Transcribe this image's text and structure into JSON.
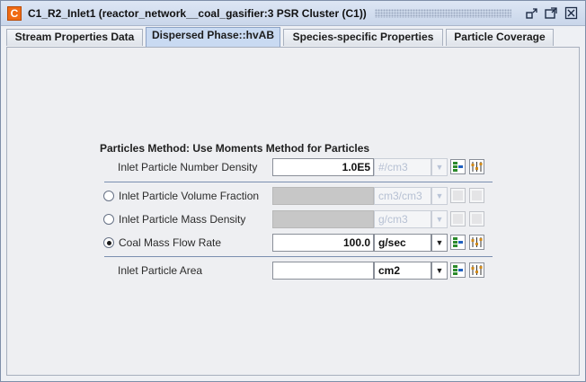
{
  "window": {
    "app_icon": "C",
    "title": "C1_R2_Inlet1  (reactor_network__coal_gasifier:3 PSR Cluster (C1))",
    "controls": {
      "minimize": "restore-down-icon",
      "maximize": "maximize-icon",
      "close": "close-icon"
    }
  },
  "tabs": [
    {
      "label": "Stream Properties Data"
    },
    {
      "label": "Dispersed Phase::hvAB"
    },
    {
      "label": "Species-specific Properties"
    },
    {
      "label": "Particle Coverage"
    }
  ],
  "form": {
    "section_title": "Particles Method: Use Moments Method for Particles",
    "number_density": {
      "label": "Inlet Particle Number Density",
      "value": "1.0E5",
      "unit": "#/cm3"
    },
    "volume_fraction": {
      "label": "Inlet Particle Volume Fraction",
      "value": "",
      "unit": "cm3/cm3",
      "selected": false
    },
    "mass_density": {
      "label": "Inlet Particle Mass Density",
      "value": "",
      "unit": "g/cm3",
      "selected": false
    },
    "coal_mass_flow": {
      "label": "Coal Mass Flow Rate",
      "value": "100.0",
      "unit": "g/sec",
      "selected": true
    },
    "particle_area": {
      "label": "Inlet Particle Area",
      "value": "",
      "unit": "cm2"
    }
  },
  "colors": {
    "accent": "#f06b14",
    "tab_active": "#c9daf2",
    "separator": "#7a8fb0"
  }
}
